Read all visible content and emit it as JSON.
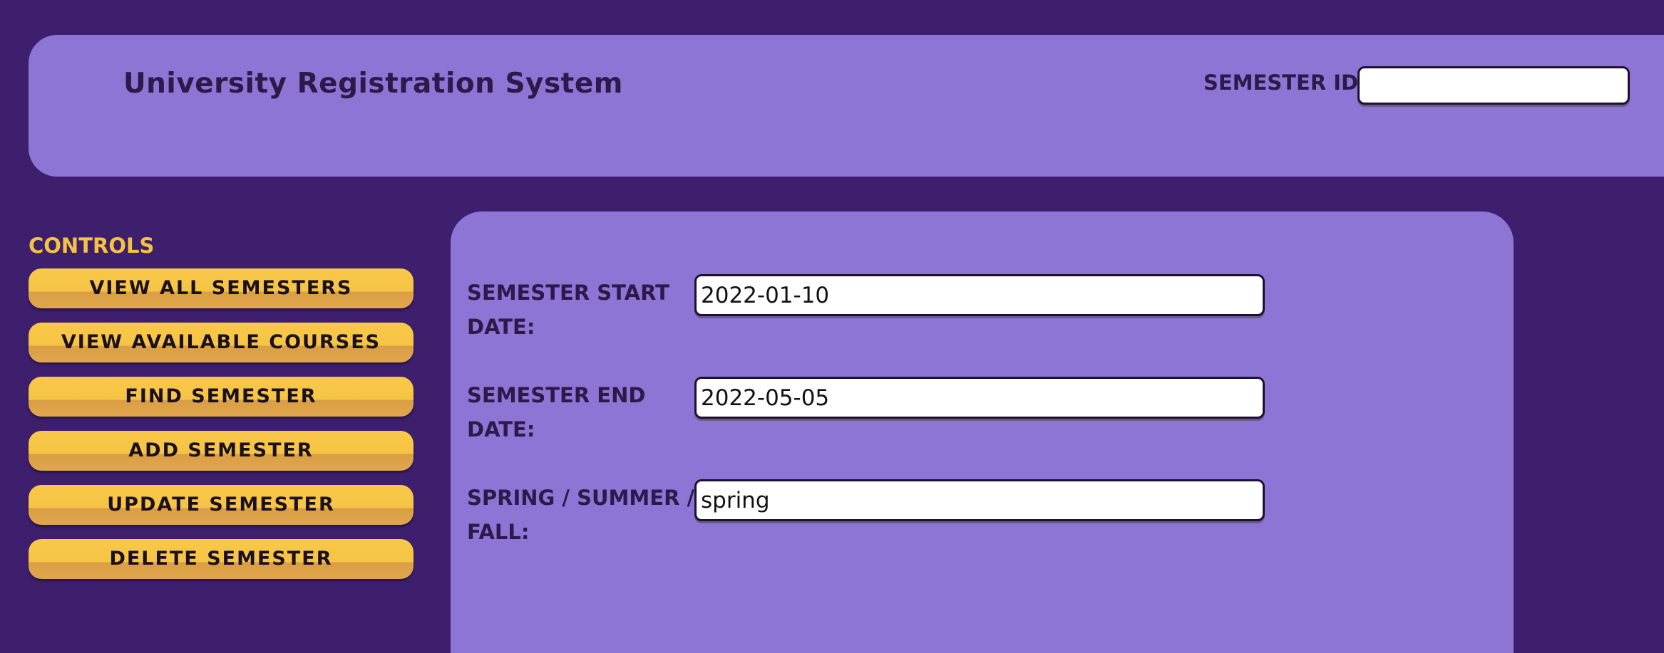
{
  "header": {
    "title": "University Registration System",
    "semester_id_label": "SEMESTER ID:",
    "semester_id_value": ""
  },
  "controls": {
    "title": "CONTROLS",
    "buttons": [
      "VIEW ALL SEMESTERS",
      "VIEW AVAILABLE COURSES",
      "FIND SEMESTER",
      "ADD SEMESTER",
      "UPDATE SEMESTER",
      "DELETE SEMESTER"
    ]
  },
  "form": {
    "fields": [
      {
        "label": "SEMESTER START DATE:",
        "value": "2022-01-10"
      },
      {
        "label": "SEMESTER END DATE:",
        "value": "2022-05-05"
      },
      {
        "label": "SPRING / SUMMER / FALL:",
        "value": "spring"
      }
    ]
  },
  "colors": {
    "page_background": "#3d1f6e",
    "panel": "#8c75d5",
    "button": "#f6c445",
    "controls_title": "#f6c244",
    "text_dark": "#2b1a4a"
  }
}
